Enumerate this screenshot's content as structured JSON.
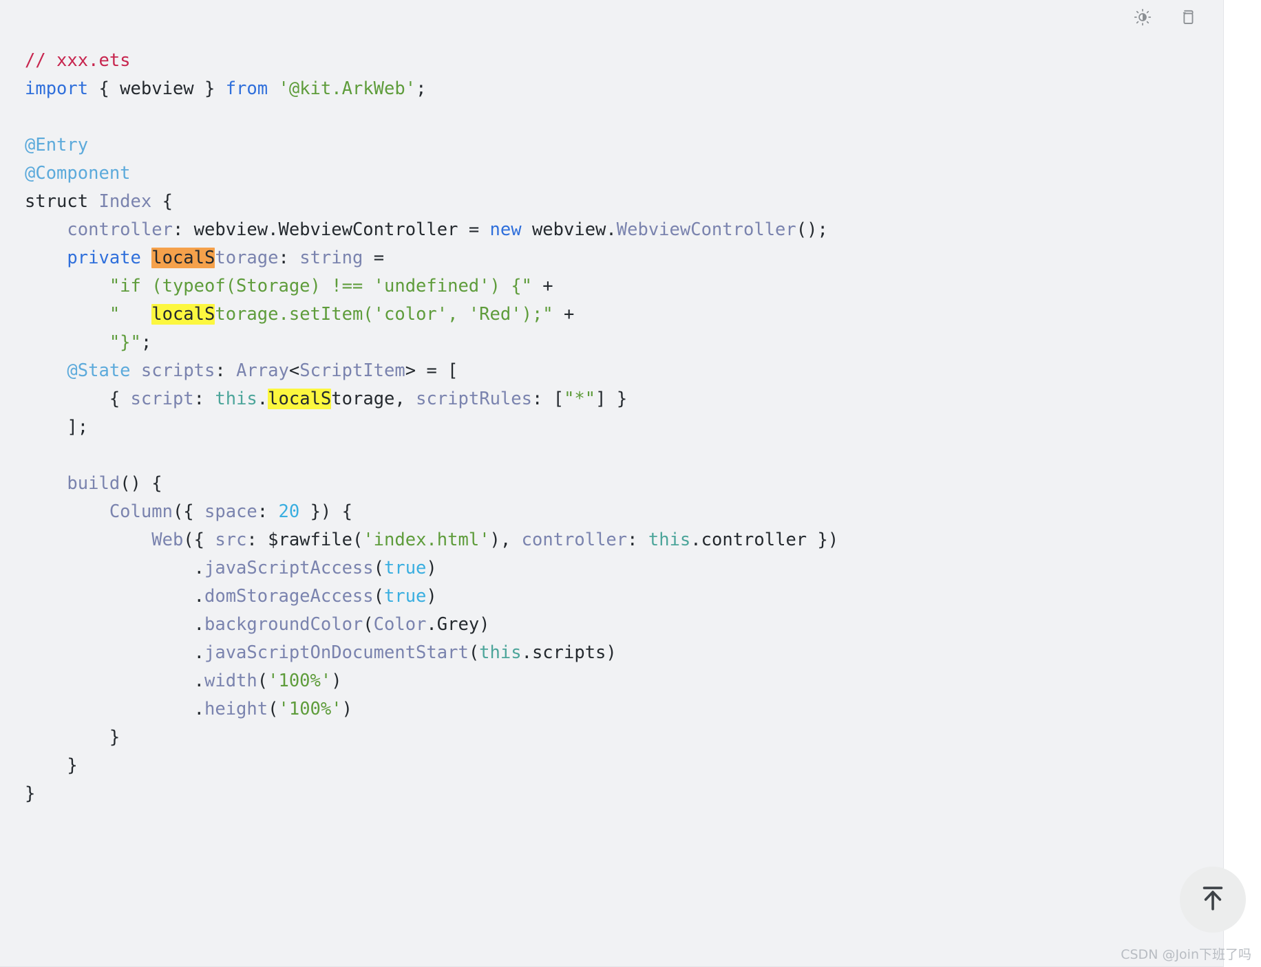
{
  "panel": {
    "background_color": "#f1f2f4",
    "language": "ets"
  },
  "toolbar": {
    "theme_toggle": {
      "name": "theme-toggle-icon",
      "title": "Toggle theme"
    },
    "copy": {
      "name": "copy-icon",
      "title": "Copy code"
    }
  },
  "scroll_top": {
    "name": "scroll-to-top-button",
    "title": "Back to top"
  },
  "watermark": {
    "text": "CSDN @Join下班了吗"
  },
  "search_highlight": {
    "query": "localS",
    "current_match_color": "#f5a14b",
    "other_match_color": "#fcf73f",
    "match_count": 3
  },
  "code": {
    "lines": [
      [
        {
          "t": "// xxx.ets",
          "c": "t-comment"
        }
      ],
      [
        {
          "t": "import",
          "c": "t-kw"
        },
        {
          "t": " { webview } ",
          "c": "t-plain"
        },
        {
          "t": "from",
          "c": "t-kw"
        },
        {
          "t": " ",
          "c": "t-plain"
        },
        {
          "t": "'@kit.ArkWeb'",
          "c": "t-str"
        },
        {
          "t": ";",
          "c": "t-plain"
        }
      ],
      [],
      [
        {
          "t": "@Entry",
          "c": "t-deco"
        }
      ],
      [
        {
          "t": "@Component",
          "c": "t-deco"
        }
      ],
      [
        {
          "t": "struct ",
          "c": "t-plain"
        },
        {
          "t": "Index",
          "c": "t-type"
        },
        {
          "t": " {",
          "c": "t-plain"
        }
      ],
      [
        {
          "t": "    ",
          "c": "t-plain"
        },
        {
          "t": "controller",
          "c": "t-prop"
        },
        {
          "t": ": webview.WebviewController = ",
          "c": "t-plain"
        },
        {
          "t": "new",
          "c": "t-kw"
        },
        {
          "t": " webview.",
          "c": "t-plain"
        },
        {
          "t": "WebviewController",
          "c": "t-type"
        },
        {
          "t": "();",
          "c": "t-plain"
        }
      ],
      [
        {
          "t": "    ",
          "c": "t-plain"
        },
        {
          "t": "private ",
          "c": "t-kw"
        },
        {
          "t": "localS",
          "c": "hl-current"
        },
        {
          "t": "torage",
          "c": "t-type"
        },
        {
          "t": ":",
          "c": "t-plain"
        },
        {
          "t": " string ",
          "c": "t-type"
        },
        {
          "t": "=",
          "c": "t-plain"
        }
      ],
      [
        {
          "t": "        ",
          "c": "t-plain"
        },
        {
          "t": "\"if (typeof(Storage) !== 'undefined') {\"",
          "c": "t-str"
        },
        {
          "t": " +",
          "c": "t-plain"
        }
      ],
      [
        {
          "t": "        ",
          "c": "t-plain"
        },
        {
          "t": "\"   ",
          "c": "t-str"
        },
        {
          "t": "localS",
          "c": "hl-match"
        },
        {
          "t": "torage.setItem('color', 'Red');\"",
          "c": "t-str"
        },
        {
          "t": " +",
          "c": "t-plain"
        }
      ],
      [
        {
          "t": "        ",
          "c": "t-plain"
        },
        {
          "t": "\"}\"",
          "c": "t-str"
        },
        {
          "t": ";",
          "c": "t-plain"
        }
      ],
      [
        {
          "t": "    ",
          "c": "t-plain"
        },
        {
          "t": "@State",
          "c": "t-deco"
        },
        {
          "t": " ",
          "c": "t-plain"
        },
        {
          "t": "scripts",
          "c": "t-prop"
        },
        {
          "t": ": ",
          "c": "t-plain"
        },
        {
          "t": "Array",
          "c": "t-type"
        },
        {
          "t": "<",
          "c": "t-plain"
        },
        {
          "t": "ScriptItem",
          "c": "t-type"
        },
        {
          "t": "> = [",
          "c": "t-plain"
        }
      ],
      [
        {
          "t": "        { ",
          "c": "t-plain"
        },
        {
          "t": "script",
          "c": "t-prop"
        },
        {
          "t": ": ",
          "c": "t-plain"
        },
        {
          "t": "this",
          "c": "t-this"
        },
        {
          "t": ".",
          "c": "t-plain"
        },
        {
          "t": "localS",
          "c": "hl-match"
        },
        {
          "t": "torage, ",
          "c": "t-plain"
        },
        {
          "t": "scriptRules",
          "c": "t-prop"
        },
        {
          "t": ": [",
          "c": "t-plain"
        },
        {
          "t": "\"*\"",
          "c": "t-str"
        },
        {
          "t": "] }",
          "c": "t-plain"
        }
      ],
      [
        {
          "t": "    ];",
          "c": "t-plain"
        }
      ],
      [],
      [
        {
          "t": "    ",
          "c": "t-plain"
        },
        {
          "t": "build",
          "c": "t-type"
        },
        {
          "t": "() {",
          "c": "t-plain"
        }
      ],
      [
        {
          "t": "        ",
          "c": "t-plain"
        },
        {
          "t": "Column",
          "c": "t-type"
        },
        {
          "t": "({ ",
          "c": "t-plain"
        },
        {
          "t": "space",
          "c": "t-prop"
        },
        {
          "t": ": ",
          "c": "t-plain"
        },
        {
          "t": "20",
          "c": "t-num"
        },
        {
          "t": " }) {",
          "c": "t-plain"
        }
      ],
      [
        {
          "t": "            ",
          "c": "t-plain"
        },
        {
          "t": "Web",
          "c": "t-type"
        },
        {
          "t": "({ ",
          "c": "t-plain"
        },
        {
          "t": "src",
          "c": "t-prop"
        },
        {
          "t": ": $rawfile(",
          "c": "t-plain"
        },
        {
          "t": "'index.html'",
          "c": "t-str"
        },
        {
          "t": "), ",
          "c": "t-plain"
        },
        {
          "t": "controller",
          "c": "t-prop"
        },
        {
          "t": ": ",
          "c": "t-plain"
        },
        {
          "t": "this",
          "c": "t-this"
        },
        {
          "t": ".controller })",
          "c": "t-plain"
        }
      ],
      [
        {
          "t": "                .",
          "c": "t-plain"
        },
        {
          "t": "javaScriptAccess",
          "c": "t-type"
        },
        {
          "t": "(",
          "c": "t-plain"
        },
        {
          "t": "true",
          "c": "t-num"
        },
        {
          "t": ")",
          "c": "t-plain"
        }
      ],
      [
        {
          "t": "                .",
          "c": "t-plain"
        },
        {
          "t": "domStorageAccess",
          "c": "t-type"
        },
        {
          "t": "(",
          "c": "t-plain"
        },
        {
          "t": "true",
          "c": "t-num"
        },
        {
          "t": ")",
          "c": "t-plain"
        }
      ],
      [
        {
          "t": "                .",
          "c": "t-plain"
        },
        {
          "t": "backgroundColor",
          "c": "t-type"
        },
        {
          "t": "(",
          "c": "t-plain"
        },
        {
          "t": "Color",
          "c": "t-type"
        },
        {
          "t": ".Grey)",
          "c": "t-plain"
        }
      ],
      [
        {
          "t": "                .",
          "c": "t-plain"
        },
        {
          "t": "javaScriptOnDocumentStart",
          "c": "t-type"
        },
        {
          "t": "(",
          "c": "t-plain"
        },
        {
          "t": "this",
          "c": "t-this"
        },
        {
          "t": ".scripts)",
          "c": "t-plain"
        }
      ],
      [
        {
          "t": "                .",
          "c": "t-plain"
        },
        {
          "t": "width",
          "c": "t-type"
        },
        {
          "t": "(",
          "c": "t-plain"
        },
        {
          "t": "'100%'",
          "c": "t-str"
        },
        {
          "t": ")",
          "c": "t-plain"
        }
      ],
      [
        {
          "t": "                .",
          "c": "t-plain"
        },
        {
          "t": "height",
          "c": "t-type"
        },
        {
          "t": "(",
          "c": "t-plain"
        },
        {
          "t": "'100%'",
          "c": "t-str"
        },
        {
          "t": ")",
          "c": "t-plain"
        }
      ],
      [
        {
          "t": "        }",
          "c": "t-plain"
        }
      ],
      [
        {
          "t": "    }",
          "c": "t-plain"
        }
      ],
      [
        {
          "t": "}",
          "c": "t-plain"
        }
      ]
    ]
  }
}
